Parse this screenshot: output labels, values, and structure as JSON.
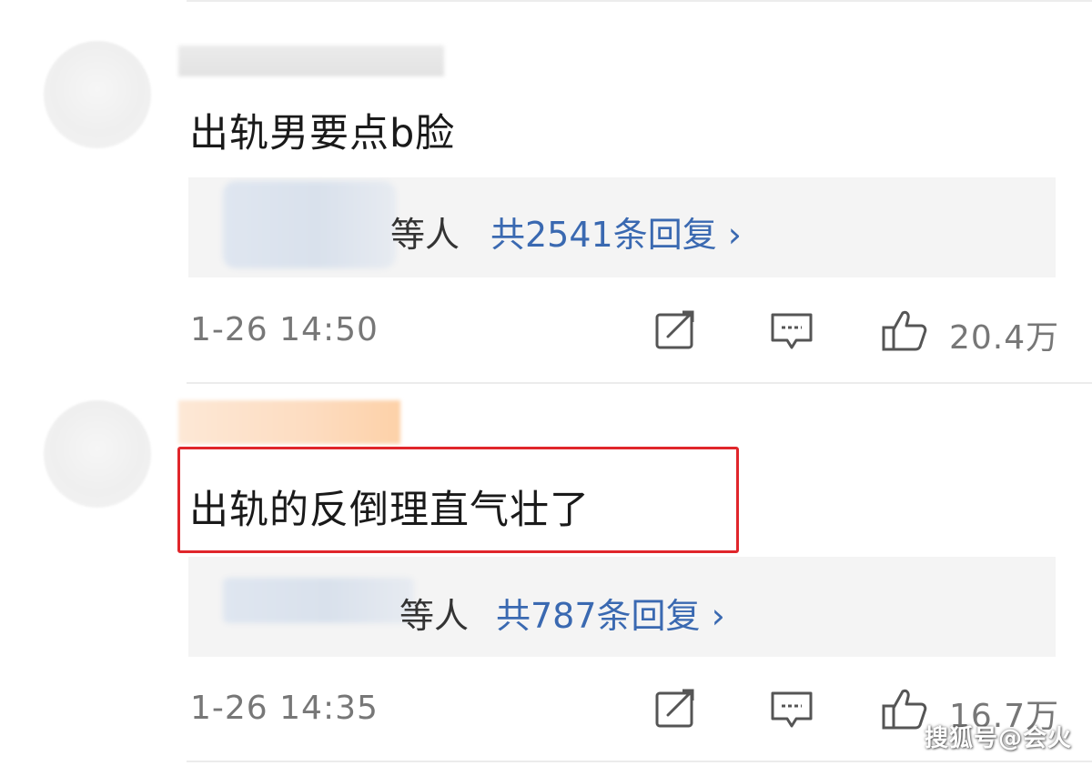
{
  "comments": [
    {
      "text": "出轨男要点b脸",
      "reply_people": "等人",
      "reply_link": "共2541条回复 ›",
      "timestamp": "1-26 14:50",
      "likes": "20.4万"
    },
    {
      "text": "出轨的反倒理直气壮了",
      "reply_people": "等人",
      "reply_link": "共787条回复 ›",
      "timestamp": "1-26 14:35",
      "likes": "16.7万"
    }
  ],
  "icons": {
    "share": "share-icon",
    "comment": "comment-icon",
    "like": "thumbs-up-icon"
  },
  "colors": {
    "link": "#3a69b1",
    "highlight": "#e0262b",
    "reply_bg": "#f4f4f4"
  },
  "watermark": "搜狐号@会火"
}
